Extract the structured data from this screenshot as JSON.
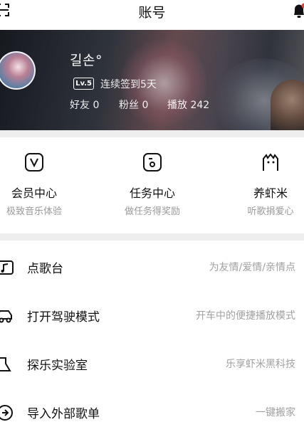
{
  "header": {
    "title": "账号",
    "left_icon": "scan-icon",
    "right_icon": "bell-icon"
  },
  "profile": {
    "username": "길손°",
    "level": "Lv.5",
    "signin_text": "连续签到5天",
    "friends": "好友 0",
    "fans": "粉丝 0",
    "plays": "播放 242"
  },
  "quick_links": [
    {
      "label": "会员中心",
      "sub": "极致音乐体验",
      "icon": "vip-icon"
    },
    {
      "label": "任务中心",
      "sub": "做任务得奖励",
      "icon": "task-icon"
    },
    {
      "label": "养虾米",
      "sub": "听歌捐爱心",
      "icon": "shrimp-icon"
    }
  ],
  "menu": [
    {
      "label": "点歌台",
      "sub": "为友情/爱情/亲情点",
      "icon": "song-request-icon"
    },
    {
      "label": "打开驾驶模式",
      "sub": "开车中的便捷播放模式",
      "icon": "car-icon"
    },
    {
      "label": "探乐实验室",
      "sub": "乐享虾米黑科技",
      "icon": "lab-icon"
    },
    {
      "label": "导入外部歌单",
      "sub": "一键搬家",
      "icon": "import-icon"
    }
  ]
}
